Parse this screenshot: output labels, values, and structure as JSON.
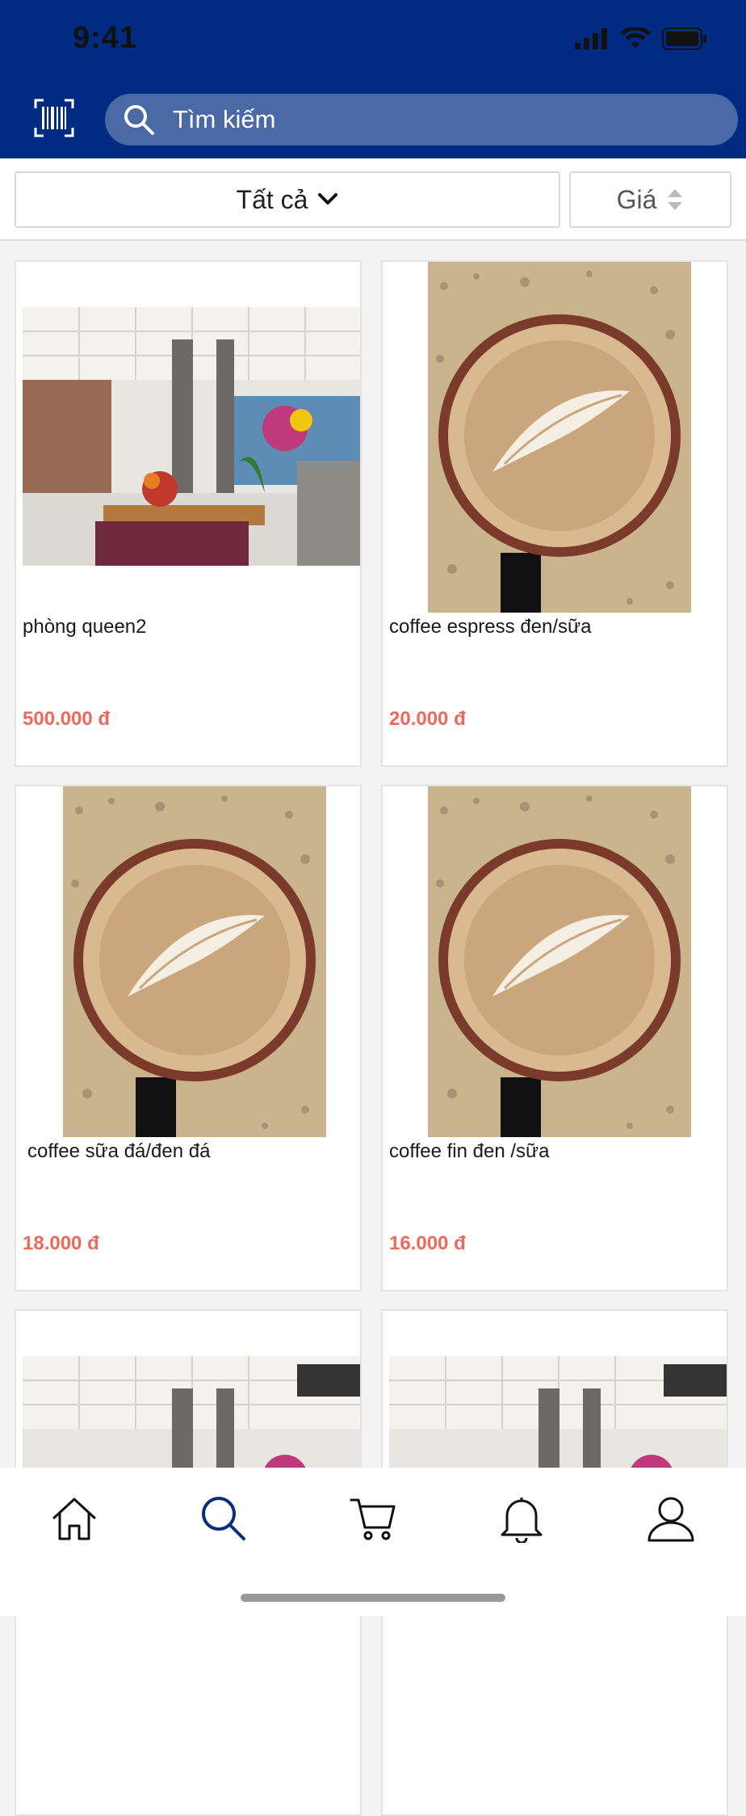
{
  "status_bar": {
    "time": "9:41"
  },
  "search": {
    "placeholder": "Tìm kiếm"
  },
  "filters": {
    "category_label": "Tất cả",
    "sort_label": "Giá"
  },
  "products": [
    {
      "name": "phòng queen2",
      "price": "500.000 đ",
      "image": "lounge-photo"
    },
    {
      "name": "coffee espress đen/sữa",
      "price": "20.000 đ",
      "image": "latte-art-photo"
    },
    {
      "name": "coffee sữa đá/đen đá",
      "price": "18.000 đ",
      "image": "latte-art-photo"
    },
    {
      "name": "coffee fin đen /sữa",
      "price": "16.000 đ",
      "image": "latte-art-photo"
    },
    {
      "name": "",
      "price": "",
      "image": "lounge-photo"
    },
    {
      "name": "",
      "price": "",
      "image": "lounge-photo"
    }
  ],
  "bottom_nav": {
    "items": [
      "home-icon",
      "search-icon",
      "cart-icon",
      "bell-icon",
      "user-icon"
    ],
    "active": "search-icon"
  },
  "colors": {
    "header": "#012b82",
    "search_bg": "#4a6aa5",
    "price": "#f0685a",
    "active_nav": "#0b2f80"
  }
}
